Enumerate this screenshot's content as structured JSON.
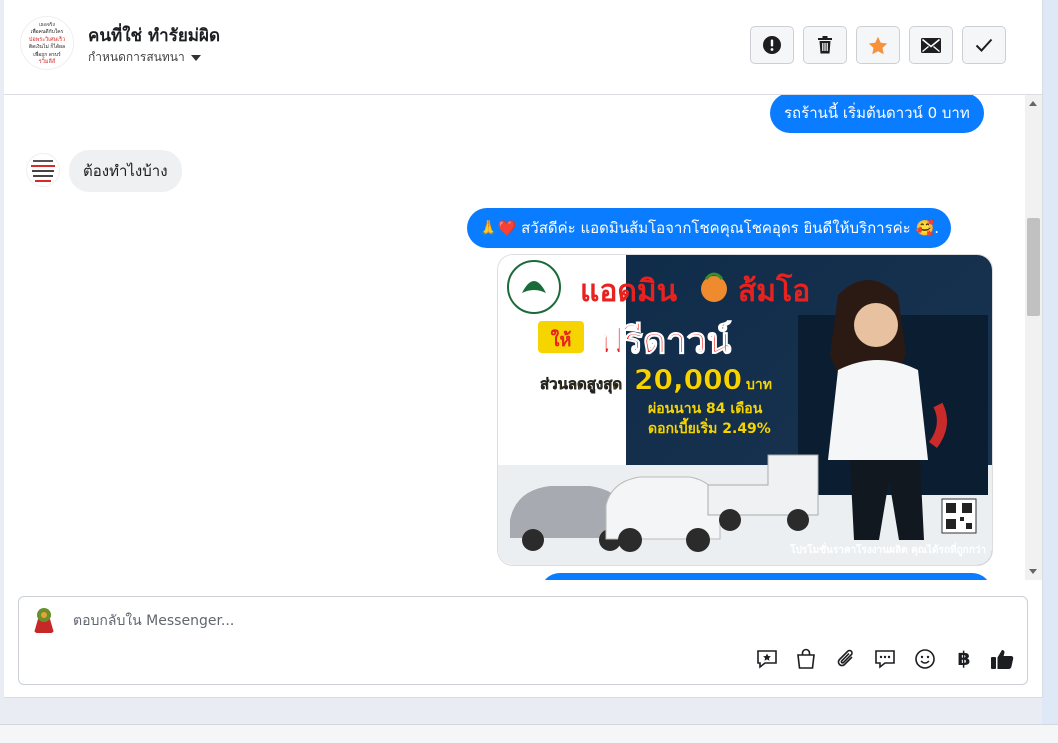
{
  "conversation": {
    "title": "คนที่ใช่ ทำรัยม่ผิด",
    "assign_label": "กำหนดการสนทนา",
    "avatar_text": [
      "เธอจริง",
      "เพื่อคนดีกับใคร",
      "ปอพระวิเศษเร็ว",
      "ติดเงินไม่ ก็ได้ผล",
      "เพื่อถูก ดรบร์",
      "รวิ่มลีส์"
    ]
  },
  "header_actions": [
    {
      "name": "report-button",
      "icon": "alert-icon"
    },
    {
      "name": "delete-button",
      "icon": "trash-icon"
    },
    {
      "name": "star-button",
      "icon": "star-icon",
      "color": "#f7923b"
    },
    {
      "name": "mark-unread-button",
      "icon": "envelope-icon"
    },
    {
      "name": "mark-done-button",
      "icon": "check-icon"
    }
  ],
  "messages": {
    "out_1": "รถร้านนี้ เริ่มต้นดาวน์ 0 บาท",
    "in_1": "ต้องทำไงบ้าง",
    "out_2_emoji": "🙏❤️",
    "out_2": "สวัสดีค่ะ แอดมินส้มโอจากโชคคุณโชคอุดร ยินดีให้บริการค่ะ",
    "out_2_tail": "🥰."
  },
  "promo": {
    "headline": "แอดมิน",
    "headline_2": "ส้มโอ",
    "give": "ให้",
    "free_down": "ฟรีดาวน์",
    "discount_label": "ส่วนลดสูงสุด",
    "discount_value": "20,000",
    "discount_unit": "บาท",
    "installment": "ผ่อนนาน 84 เดือน",
    "interest": "ดอกเบี้ยเริ่ม 2.49%",
    "footer": "โปรโมชั่นราคาโรงงานผลิต คุณได้รถที่ถูกกว่า",
    "colors": {
      "headline": "#e8231f",
      "accent": "#f5d400"
    }
  },
  "composer": {
    "placeholder": "ตอบกลับใน Messenger...",
    "tools": [
      "saved-reply-icon",
      "shopping-bag-icon",
      "attachment-icon",
      "chat-bubbles-icon",
      "emoji-icon",
      "baht-icon",
      "like-icon"
    ],
    "baht_symbol": "฿"
  },
  "brand_color": "#0a7cff"
}
